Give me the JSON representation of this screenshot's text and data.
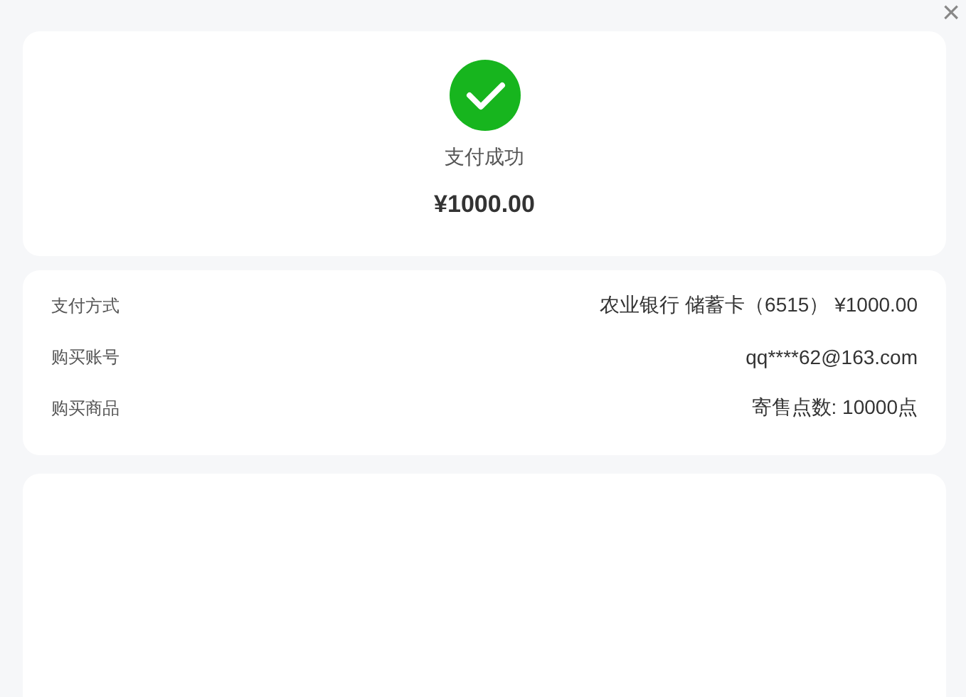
{
  "close_button": "×",
  "result": {
    "status": "支付成功",
    "amount": "¥1000.00"
  },
  "details": [
    {
      "label": "支付方式",
      "value": "农业银行 储蓄卡（6515） ¥1000.00"
    },
    {
      "label": "购买账号",
      "value": "qq****62@163.com"
    },
    {
      "label": "购买商品",
      "value": "寄售点数: 10000点"
    }
  ]
}
